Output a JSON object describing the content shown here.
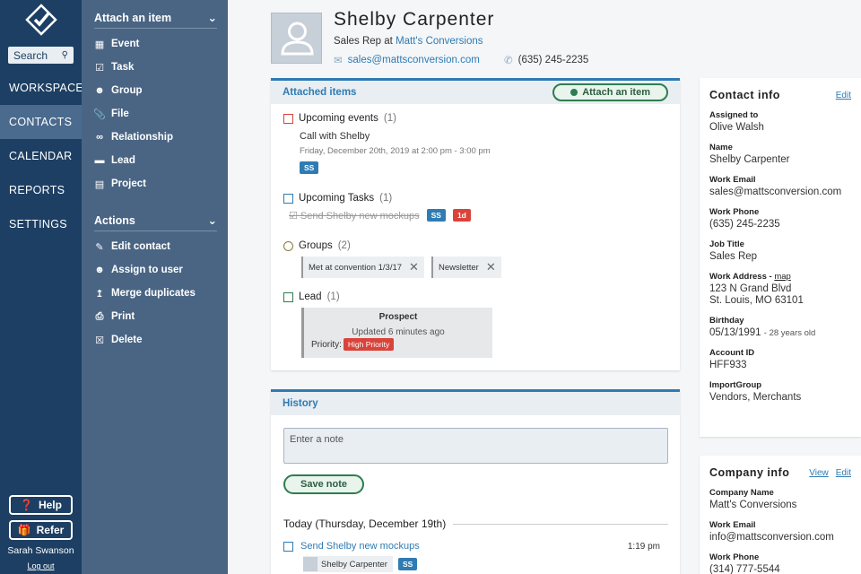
{
  "nav": {
    "search": "Search",
    "items": [
      "WORKSPACE",
      "CONTACTS",
      "CALENDAR",
      "REPORTS",
      "SETTINGS"
    ],
    "help": "Help",
    "refer": "Refer",
    "user": "Sarah Swanson",
    "logout": "Log out"
  },
  "sidebar": {
    "attach_title": "Attach an item",
    "attach_items": [
      "Event",
      "Task",
      "Group",
      "File",
      "Relationship",
      "Lead",
      "Project"
    ],
    "actions_title": "Actions",
    "actions_items": [
      "Edit contact",
      "Assign to user",
      "Merge duplicates",
      "Print",
      "Delete"
    ]
  },
  "profile": {
    "name": "Shelby Carpenter",
    "role": "Sales Rep at",
    "company": "Matt's Conversions",
    "email": "sales@mattsconversion.com",
    "phone": "(635) 245-2235"
  },
  "attached": {
    "title": "Attached items",
    "attach_button": "Attach an item",
    "events_title": "Upcoming events",
    "events_count": "(1)",
    "event_name": "Call with Shelby",
    "event_time": "Friday, December 20th, 2019 at 2:00 pm - 3:00 pm",
    "event_tag": "SS",
    "tasks_title": "Upcoming Tasks",
    "tasks_count": "(1)",
    "task_name": "Send Shelby new mockups",
    "task_tag": "SS",
    "task_due": "1d",
    "groups_title": "Groups",
    "groups_count": "(2)",
    "groups": [
      "Met at convention 1/3/17",
      "Newsletter"
    ],
    "lead_title": "Lead",
    "lead_count": "(1)",
    "lead_stage": "Prospect",
    "lead_updated": "Updated 6 minutes ago",
    "lead_priority_label": "Priority:",
    "lead_priority": "High Priority"
  },
  "history": {
    "title": "History",
    "note_placeholder": "Enter a note",
    "save": "Save note",
    "today": "Today (Thursday, December 19th)",
    "entry_title": "Send Shelby new mockups",
    "entry_time": "1:19 pm",
    "entry_user": "Shelby Carpenter",
    "entry_tag": "SS"
  },
  "contact_info": {
    "title": "Contact info",
    "edit": "Edit",
    "fields": [
      {
        "label": "Assigned to",
        "value": "Olive Walsh"
      },
      {
        "label": "Name",
        "value": "Shelby Carpenter"
      },
      {
        "label": "Work Email",
        "value": "sales@mattsconversion.com"
      },
      {
        "label": "Work Phone",
        "value": "(635) 245-2235"
      },
      {
        "label": "Job Title",
        "value": "Sales Rep"
      },
      {
        "label": "Work Address -",
        "label_link": "map",
        "value": "123 N Grand Blvd",
        "value2": "St. Louis, MO 63101"
      },
      {
        "label": "Birthday",
        "value": "05/13/1991",
        "extra": "- 28 years old"
      },
      {
        "label": "Account ID",
        "value": "HFF933"
      },
      {
        "label": "ImportGroup",
        "value": "Vendors, Merchants"
      }
    ]
  },
  "company_info": {
    "title": "Company info",
    "view": "View",
    "edit": "Edit",
    "fields": [
      {
        "label": "Company Name",
        "value": "Matt's Conversions"
      },
      {
        "label": "Work Email",
        "value": "info@mattsconversion.com"
      },
      {
        "label": "Work Phone",
        "value": "(314) 777-5544"
      }
    ]
  },
  "colors": {
    "navy": "#1d3f63",
    "sidebar": "#4a6584",
    "accent": "#2f7bb3",
    "green": "#2e7d4f",
    "red": "#d9433a"
  }
}
